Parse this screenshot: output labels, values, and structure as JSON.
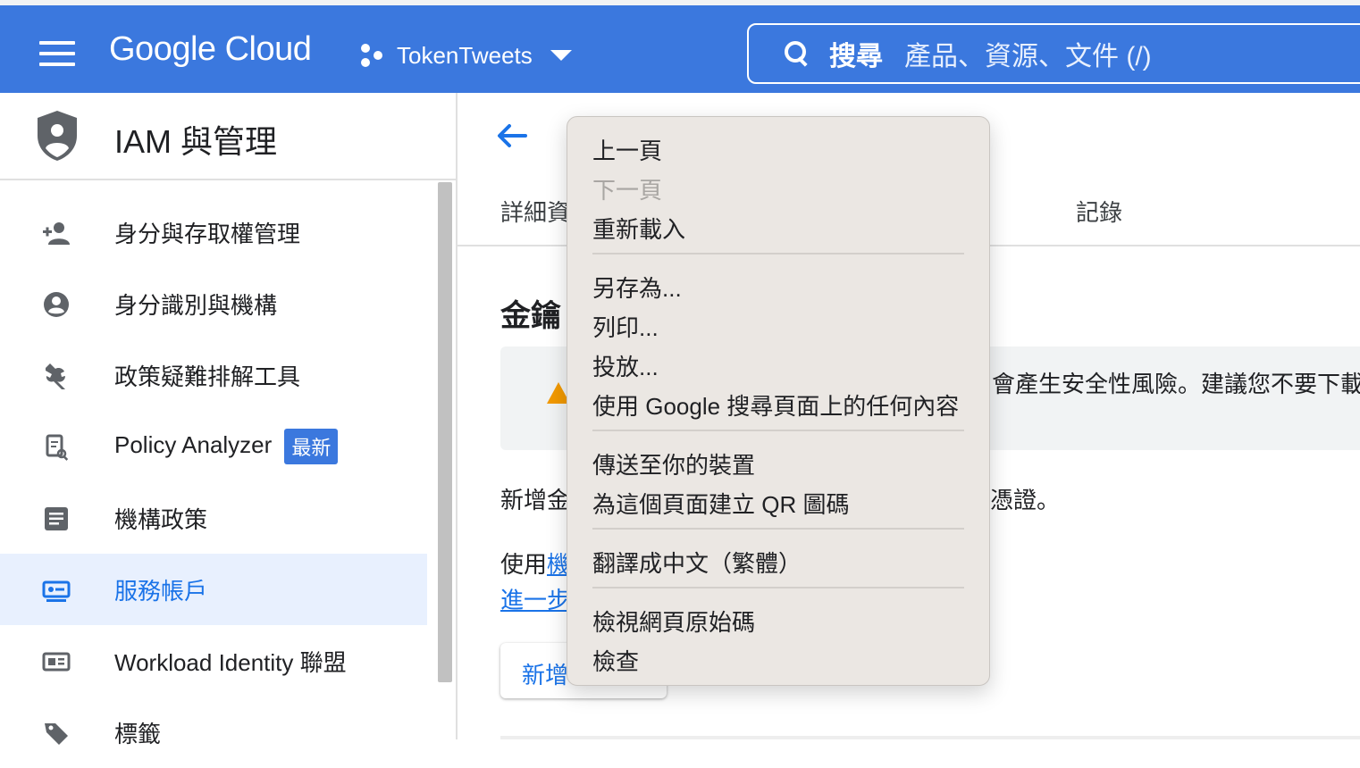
{
  "header": {
    "logo": "Google Cloud",
    "project": "TokenTweets",
    "search_label": "搜尋",
    "search_placeholder": "產品、資源、文件 (/)"
  },
  "sidebar": {
    "title": "IAM 與管理",
    "items": [
      {
        "label": "身分與存取權管理",
        "icon": "person-add-icon"
      },
      {
        "label": "身分識別與機構",
        "icon": "account-circle-icon"
      },
      {
        "label": "政策疑難排解工具",
        "icon": "wrench-icon"
      },
      {
        "label": "Policy Analyzer",
        "icon": "document-search-icon",
        "badge": "最新"
      },
      {
        "label": "機構政策",
        "icon": "list-document-icon"
      },
      {
        "label": "服務帳戶",
        "icon": "service-account-icon",
        "active": true
      },
      {
        "label": "Workload Identity 聯盟",
        "icon": "id-card-icon"
      },
      {
        "label": "標籤",
        "icon": "tag-icon"
      }
    ]
  },
  "main": {
    "tabs": [
      "詳細資",
      "記錄"
    ],
    "section_title": "金鑰",
    "warning_text": "會產生安全性風險。建議您不要下載",
    "para1_start": "新增金",
    "para1_end": "憑證。",
    "para2_start": "使用",
    "para2_link": "機",
    "para3_link": "進一步",
    "add_button": "新增"
  },
  "context_menu": {
    "items": [
      {
        "label": "上一頁",
        "disabled": false
      },
      {
        "label": "下一頁",
        "disabled": true
      },
      {
        "label": "重新載入",
        "disabled": false
      },
      {
        "label": "另存為...",
        "disabled": false
      },
      {
        "label": "列印...",
        "disabled": false
      },
      {
        "label": "投放...",
        "disabled": false
      },
      {
        "label": "使用 Google 搜尋頁面上的任何內容",
        "disabled": false
      },
      {
        "label": "傳送至你的裝置",
        "disabled": false
      },
      {
        "label": "為這個頁面建立 QR 圖碼",
        "disabled": false
      },
      {
        "label": "翻譯成中文（繁體）",
        "disabled": false
      },
      {
        "label": "檢視網頁原始碼",
        "disabled": false
      },
      {
        "label": "檢查",
        "disabled": false
      }
    ]
  },
  "colors": {
    "topbar": "#3b78de",
    "accent": "#1a73e8",
    "active_bg": "#e8f0fe",
    "menu_bg": "#ebe7e3"
  }
}
